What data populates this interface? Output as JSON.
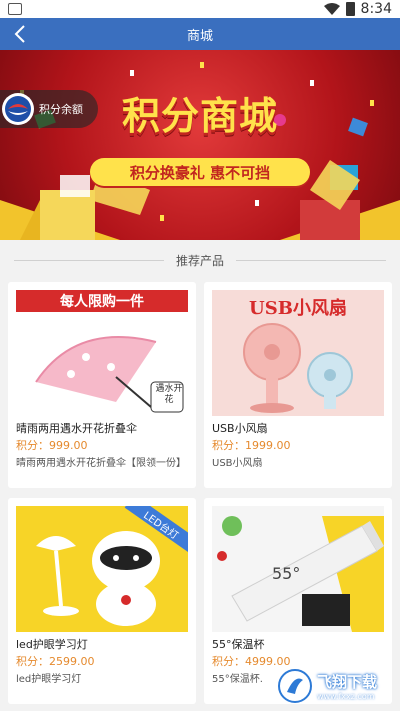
{
  "status_bar": {
    "time": "8:34"
  },
  "nav": {
    "title": "商城"
  },
  "banner": {
    "headline": "积分商城",
    "subline": "积分换豪礼 惠不可挡"
  },
  "points_button": {
    "label": "积分余额"
  },
  "section": {
    "title": "推荐产品"
  },
  "products": [
    {
      "name": "晴雨两用遇水开花折叠伞",
      "price": "积分：999.00",
      "desc": "晴雨两用遇水开花折叠伞【限领一份】",
      "image_banner": "每人限购一件",
      "image_tag": "遇水开花"
    },
    {
      "name": "USB小风扇",
      "price": "积分：1999.00",
      "desc": "USB小风扇",
      "image_banner": "USB小风扇"
    },
    {
      "name": "led护眼学习灯",
      "price": "积分：2599.00",
      "desc": "led护眼学习灯",
      "image_banner": "LED台灯"
    },
    {
      "name": "55°保温杯",
      "price": "积分：4999.00",
      "desc": "55°保温杯.",
      "image_banner": "55°"
    }
  ],
  "watermark": {
    "name": "飞翔下载",
    "url": "www.fxxz.com"
  },
  "colors": {
    "nav": "#3a6fbf",
    "price": "#e58a2e",
    "banner_red": "#b2141a",
    "banner_yellow": "#ffe24b"
  }
}
